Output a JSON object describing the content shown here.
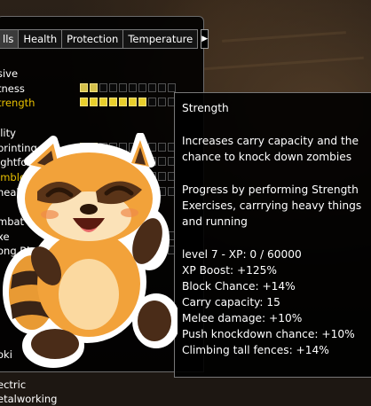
{
  "tabs": [
    "lls",
    "Health",
    "Protection",
    "Temperature"
  ],
  "tab_arrow": "▶",
  "skills": [
    {
      "label": "sive",
      "filled": null,
      "highlight": false
    },
    {
      "label": "tness",
      "filled": 2,
      "highlight": false
    },
    {
      "label": "trength",
      "filled": 7,
      "highlight": true
    },
    {
      "label": "",
      "filled": null,
      "highlight": false
    },
    {
      "label": "ility",
      "filled": null,
      "highlight": false
    },
    {
      "label": "printing",
      "filled": 2,
      "highlight": false
    },
    {
      "label": "ightfooted",
      "filled": 2,
      "highlight": false
    },
    {
      "label": "imble",
      "filled": 2,
      "highlight": true
    },
    {
      "label": "neaki",
      "filled": 0,
      "highlight": false
    },
    {
      "label": "",
      "filled": null,
      "highlight": false
    },
    {
      "label": "mbat",
      "filled": null,
      "highlight": false
    },
    {
      "label": "xe",
      "filled": 0,
      "highlight": false
    },
    {
      "label": "ong Bl",
      "filled": 0,
      "highlight": false
    },
    {
      "label": "",
      "filled": null,
      "highlight": false
    },
    {
      "label": "",
      "filled": null,
      "highlight": false
    },
    {
      "label": "",
      "filled": null,
      "highlight": false
    },
    {
      "label": "",
      "filled": null,
      "highlight": false
    },
    {
      "label": "",
      "filled": null,
      "highlight": false
    },
    {
      "label": "",
      "filled": null,
      "highlight": false
    },
    {
      "label": "oki",
      "filled": null,
      "highlight": false
    },
    {
      "label": "",
      "filled": null,
      "highlight": false
    },
    {
      "label": "ectric",
      "filled": null,
      "highlight": false
    },
    {
      "label": "etalworking",
      "filled": null,
      "highlight": false
    }
  ],
  "tooltip": {
    "title": "Strength",
    "description_1": "Increases carry capacity and the",
    "description_2": "chance to knock down zombies",
    "progress_1": "Progress by performing Strength",
    "progress_2": "Exercises, carrrying heavy things",
    "progress_3": "and running",
    "level": "level 7 - XP: 0 / 60000",
    "xp_boost": "XP Boost: +125%",
    "block_chance": "Block Chance: +14%",
    "carry_capacity": "Carry capacity: 15",
    "melee_damage": "Melee damage: +10%",
    "push_knockdown": "Push knockdown chance: +10%",
    "climbing": "Climbing tall fences: +14%"
  },
  "colors": {
    "highlight": "#e8c000",
    "filled_box": "#d4c04a",
    "mascot_fur": "#f2a23a"
  },
  "icons": {
    "mascot": "raccoon-mascot-sticker",
    "tab_arrow": "right-arrow-icon"
  }
}
